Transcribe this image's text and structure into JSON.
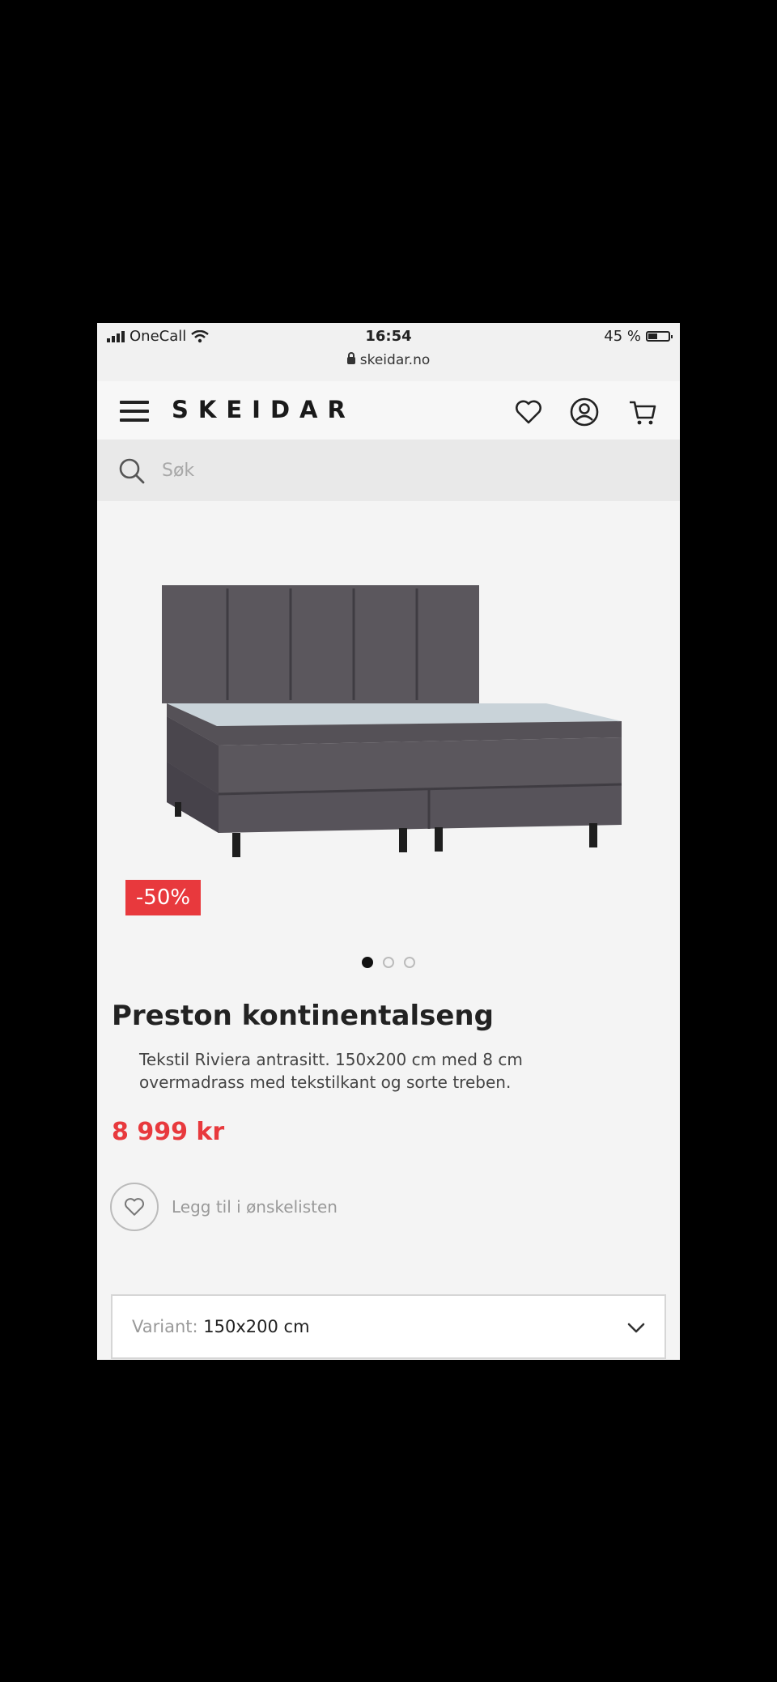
{
  "status_bar": {
    "carrier": "OneCall",
    "time": "16:54",
    "battery": "45 %",
    "url": "skeidar.no"
  },
  "header": {
    "logo": "SKEIDAR",
    "icons": [
      "menu-icon",
      "heart-icon",
      "user-icon",
      "cart-icon"
    ]
  },
  "search": {
    "placeholder": "Søk"
  },
  "product": {
    "badge": "-50%",
    "title": "Preston kontinentalseng",
    "description": "Tekstil Riviera antrasitt. 150x200 cm med 8 cm overmadrass med tekstilkant og sorte treben.",
    "price": "8 999 kr",
    "image_count": 3,
    "active_image": 1,
    "wishlist_label": "Legg til i ønskelisten"
  },
  "variant": {
    "label": "Variant:",
    "value": "150x200 cm"
  },
  "colors": {
    "accent": "#e8393d",
    "background": "#f4f4f4",
    "bed_fabric": "#5b575d"
  }
}
